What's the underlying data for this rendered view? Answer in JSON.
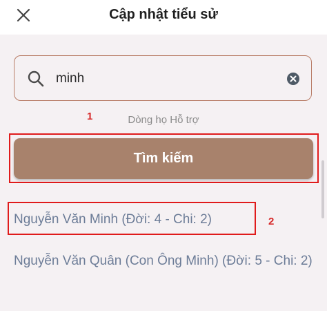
{
  "header": {
    "title": "Cập nhật tiểu sử",
    "close_icon": "close-icon"
  },
  "search": {
    "value": "minh",
    "search_icon": "search-icon",
    "clear_icon": "clear-circle-icon"
  },
  "helper_text": "Dòng họ Hỗ trợ",
  "search_button": {
    "label": "Tìm kiếm"
  },
  "results": [
    {
      "text": "Nguyễn Văn Minh (Đời: 4 - Chi: 2)"
    },
    {
      "text": "Nguyễn Văn Quân (Con Ông Minh) (Đời: 5 - Chi: 2)"
    }
  ],
  "annotations": {
    "marker_1": "1",
    "marker_2": "2"
  },
  "colors": {
    "accent": "#a8826c",
    "highlight": "#e01b1b",
    "result_text": "#6c7c97"
  }
}
